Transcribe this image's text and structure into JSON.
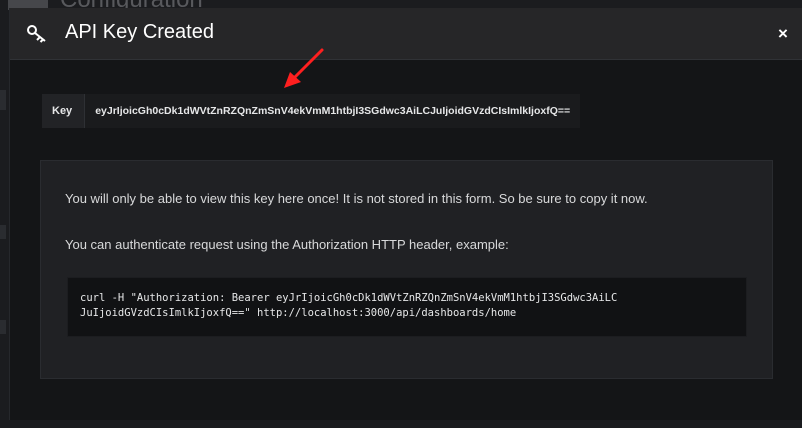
{
  "background": {
    "partial_title": "Configuration"
  },
  "modal": {
    "title": "API Key Created",
    "close_label": "×",
    "icon": "key-icon"
  },
  "key": {
    "label": "Key",
    "value": "eyJrIjoicGh0cDk1dWVtZnRZQnZmSnV4ekVmM1htbjI3SGdwc3AiLCJuIjoidGVzdCIsImlkIjoxfQ=="
  },
  "info": {
    "warning": "You will only be able to view this key here once! It is not stored in this form. So be sure to copy it now.",
    "auth_hint": "You can authenticate request using the Authorization HTTP header, example:",
    "code_line_1": "curl -H \"Authorization: Bearer eyJrIjoicGh0cDk1dWVtZnRZQnZmSnV4ekVmM1htbjI3SGdwc3AiLC",
    "code_line_2": "JuIjoidGVzdCIsImlkIjoxfQ==\" http://localhost:3000/api/dashboards/home"
  },
  "annotation": {
    "arrow_color": "#ff1f1f"
  },
  "colors": {
    "modal_bg": "#141517",
    "header_bg": "#262628",
    "text": "#d8d9da"
  }
}
